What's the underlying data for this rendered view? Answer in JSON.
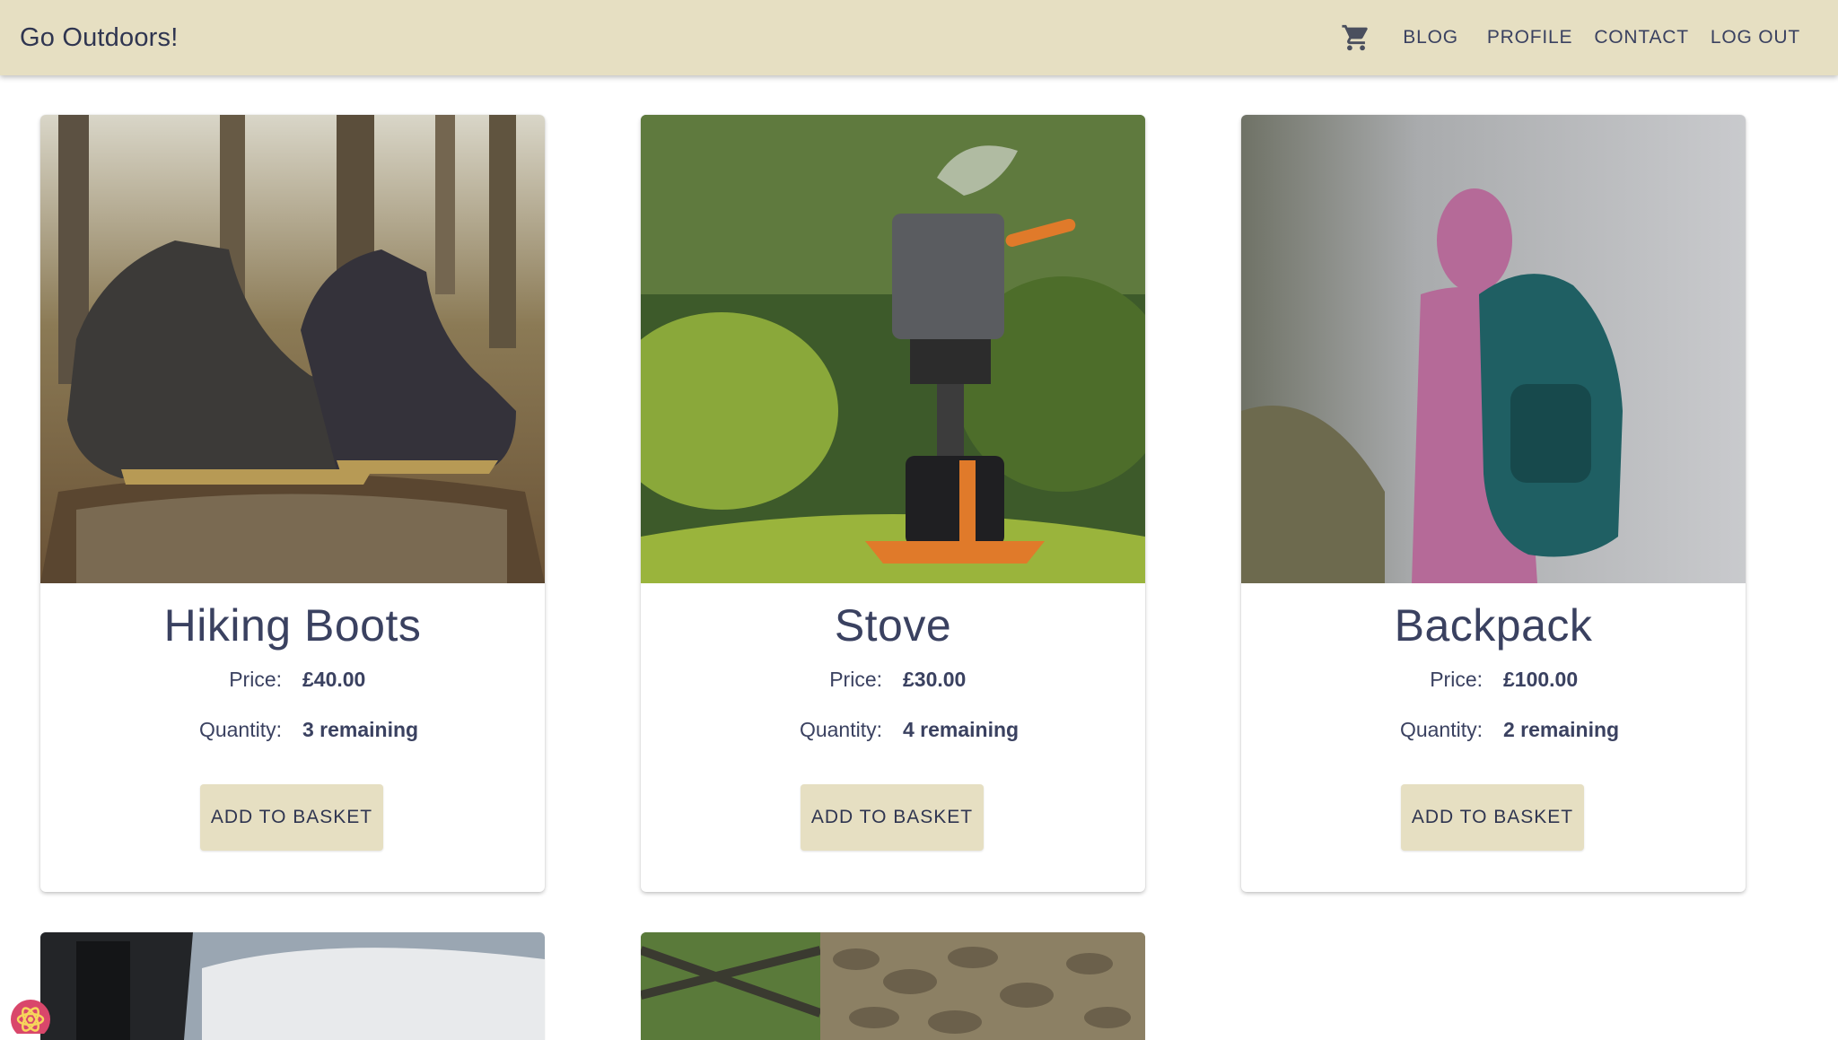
{
  "app": {
    "title": "Go Outdoors!"
  },
  "nav": {
    "cart_icon": "shopping-cart-icon",
    "links": [
      "BLOG",
      "PROFILE",
      "CONTACT",
      "LOG OUT"
    ]
  },
  "colors": {
    "appbar": "#e6dfc2",
    "button": "#e6dfc2",
    "text": "#3a4160"
  },
  "products": [
    {
      "name": "Hiking Boots",
      "price_label": "Price:",
      "price": "£40.00",
      "qty_label": "Quantity:",
      "quantity": "3 remaining",
      "button": "ADD TO BASKET",
      "image": "hiking-boots-photo"
    },
    {
      "name": "Stove",
      "price_label": "Price:",
      "price": "£30.00",
      "qty_label": "Quantity:",
      "quantity": "4 remaining",
      "button": "ADD TO BASKET",
      "image": "camping-stove-photo"
    },
    {
      "name": "Backpack",
      "price_label": "Price:",
      "price": "£100.00",
      "qty_label": "Quantity:",
      "quantity": "2 remaining",
      "button": "ADD TO BASKET",
      "image": "hiker-backpack-photo"
    }
  ],
  "partial_products": [
    {
      "image": "hiker-clouds-photo"
    },
    {
      "image": "stone-wall-gate-photo"
    }
  ],
  "devtools_badge": "react-devtools-icon"
}
